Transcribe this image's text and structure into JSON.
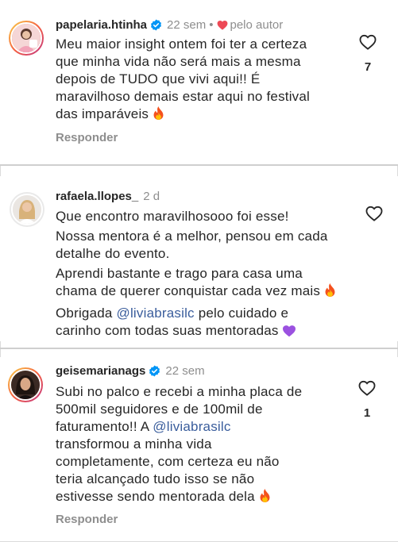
{
  "comments": [
    {
      "username": "papelaria.htinha",
      "verified": true,
      "time": "22 sem",
      "separator": "•",
      "liked_by_author": "pelo autor",
      "text_lines": [
        "Meu maior insight ontem foi ter a certeza",
        "que minha vida não será mais a mesma",
        "depois de TUDO que vivi aqui!! É",
        "maravilhoso demais estar aqui no festival",
        "das imparáveis"
      ],
      "likes": "7",
      "reply_label": "Responder"
    },
    {
      "username": "rafaela.llopes_",
      "verified": false,
      "time": "2 d",
      "paragraphs": [
        "Que encontro maravilhosooo foi esse!",
        "Nossa mentora é a melhor, pensou em cada detalhe do evento.",
        "Aprendi bastante e trago para casa uma chama de querer conquistar cada vez mais",
        "pelo cuidado e carinho com todas suas mentoradas"
      ],
      "thanks_prefix": "Obrigada",
      "mention": "@liviabrasilc"
    },
    {
      "username": "geisemarianags",
      "verified": true,
      "time": "22 sem",
      "line1": "Subi no palco e recebi a minha placa de",
      "line2": "500mil seguidores e de 100mil de",
      "line3_prefix": "faturamento!! A",
      "mention": "@liviabrasilc",
      "rest_lines": [
        "transformou a minha vida",
        "completamente, com certeza eu não",
        "teria alcançado tudo isso se não",
        "estivesse sendo mentorada dela"
      ],
      "likes": "1",
      "reply_label": "Responder"
    }
  ],
  "icons": {
    "verified": "verified-badge-icon",
    "like": "heart-outline-icon",
    "liked_by_author": "heart-filled-icon",
    "fire": "fire-emoji",
    "purple_heart": "purple-heart-emoji"
  },
  "colors": {
    "text": "#262626",
    "muted": "#8e8e8e",
    "verified": "#0095f6",
    "author_heart": "#ed4956",
    "mention": "#3a5d9c"
  }
}
